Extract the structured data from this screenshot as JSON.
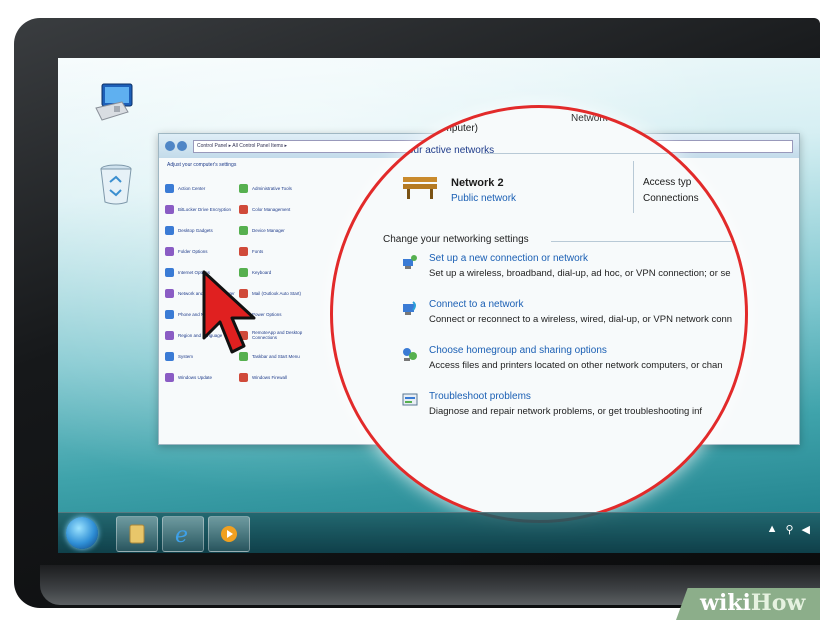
{
  "desktop": {
    "icons": [
      {
        "name": "computer-icon"
      },
      {
        "name": "recycle-bin-icon"
      }
    ]
  },
  "control_panel": {
    "address": "Control Panel ▸ All Control Panel Items ▸",
    "heading": "Adjust your computer's settings",
    "items": [
      "Action Center",
      "Administrative Tools",
      "",
      "BitLocker Drive Encryption",
      "Color Management",
      "",
      "Desktop Gadgets",
      "Device Manager",
      "",
      "Folder Options",
      "Fonts",
      "",
      "Internet Options",
      "Keyboard",
      "",
      "Network and Sharing Center",
      "Mail (Outlook Auto Start)",
      "",
      "Phone and Modem",
      "Power Options",
      "",
      "Region and Language",
      "RemoteApp and Desktop Connections",
      "",
      "System",
      "Taskbar and Start Menu",
      "",
      "Windows Update",
      "Windows Firewall",
      ""
    ]
  },
  "network_center": {
    "top_left": "computer)",
    "top_right": "Network",
    "active_networks_label": "your active networks",
    "network_name": "Network  2",
    "network_type": "Public network",
    "access_type_label": "Access typ",
    "connections_label": "Connections",
    "change_settings_heading": "Change your networking settings",
    "options": [
      {
        "title": "Set up a new connection or network",
        "desc": "Set up a wireless, broadband, dial-up, ad hoc, or VPN connection; or se"
      },
      {
        "title": "Connect to a network",
        "desc": "Connect or reconnect to a wireless, wired, dial-up, or VPN network conn"
      },
      {
        "title": "Choose homegroup and sharing options",
        "desc": "Access files and printers located on other network computers, or chan"
      },
      {
        "title": "Troubleshoot problems",
        "desc": "Diagnose and repair network problems, or get troubleshooting inf"
      }
    ]
  },
  "taskbar": {
    "buttons": [
      "start-button",
      "explorer-button",
      "ie-button",
      "media-player-button"
    ]
  },
  "watermark": {
    "part1": "wiki",
    "part2": "How"
  },
  "colors": {
    "highlight_circle": "#e22a2a",
    "link": "#1a5fb4",
    "cursor": "#e02020"
  }
}
